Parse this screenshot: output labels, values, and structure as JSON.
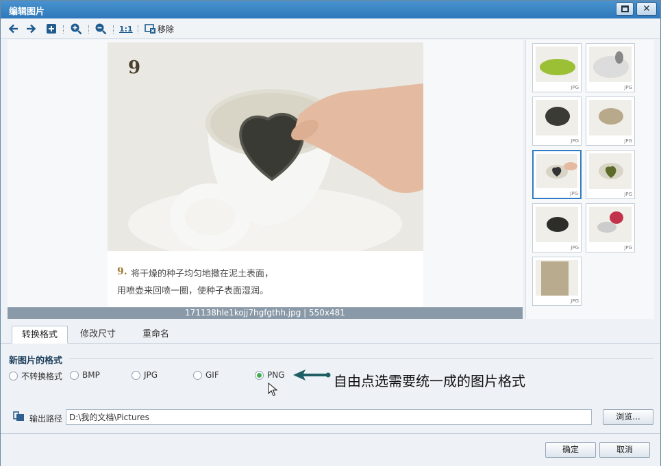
{
  "window": {
    "title": "编辑图片"
  },
  "toolbar": {
    "one_to_one_label": "1:1",
    "remove_label": "移除",
    "icons": [
      "arrow-left-icon",
      "arrow-right-icon",
      "plus-square-icon",
      "zoom-in-icon",
      "zoom-out-icon",
      "actual-size-icon",
      "remove-icon"
    ]
  },
  "preview": {
    "caption_number": "9.",
    "caption_line1": "将干燥的种子均匀地撒在泥土表面，",
    "caption_line2": "用喷壶来回喷一圈，使种子表面湿润。",
    "photo_step_number": "9",
    "info": "171138hle1kojj7hgfgthh.jpg | 550x481"
  },
  "thumbnails": [
    {
      "ext": "JPG",
      "selected": false
    },
    {
      "ext": "JPG",
      "selected": false
    },
    {
      "ext": "JPG",
      "selected": false
    },
    {
      "ext": "JPG",
      "selected": false
    },
    {
      "ext": "JPG",
      "selected": true
    },
    {
      "ext": "JPG",
      "selected": false
    },
    {
      "ext": "JPG",
      "selected": false
    },
    {
      "ext": "JPG",
      "selected": false
    },
    {
      "ext": "JPG",
      "selected": false
    }
  ],
  "tabs": [
    {
      "label": "转换格式",
      "active": true
    },
    {
      "label": "修改尺寸",
      "active": false
    },
    {
      "label": "重命名",
      "active": false
    }
  ],
  "format": {
    "section_title": "新图片的格式",
    "options": [
      {
        "label": "不转换格式",
        "checked": false
      },
      {
        "label": "BMP",
        "checked": false
      },
      {
        "label": "JPG",
        "checked": false
      },
      {
        "label": "GIF",
        "checked": false
      },
      {
        "label": "PNG",
        "checked": true
      }
    ],
    "annotation": "自由点选需要统一成的图片格式"
  },
  "output": {
    "label": "输出路径",
    "path": "D:\\我的文档\\Pictures",
    "browse_label": "浏览..."
  },
  "footer": {
    "ok_label": "确定",
    "cancel_label": "取消"
  },
  "colors": {
    "titlebar": "#2e78bb",
    "selection": "#2f7cc4",
    "radio_checked": "#3fae4c",
    "annotation_arrow": "#1f5f63"
  }
}
